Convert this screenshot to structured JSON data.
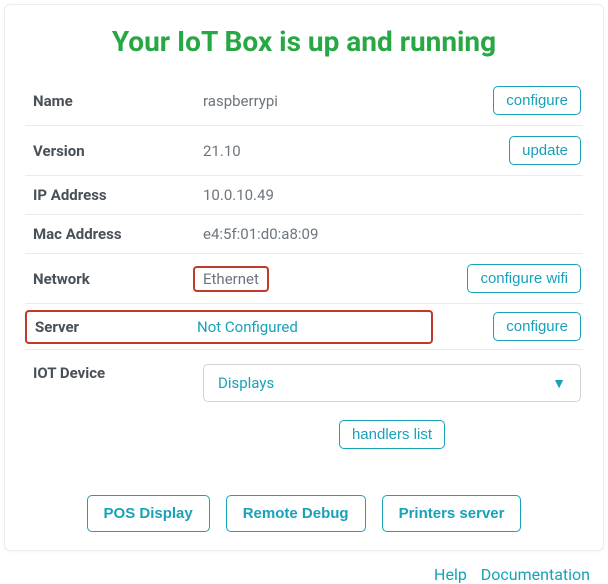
{
  "title": "Your IoT Box is up and running",
  "rows": {
    "name": {
      "label": "Name",
      "value": "raspberrypi",
      "action": "configure"
    },
    "version": {
      "label": "Version",
      "value": "21.10",
      "action": "update"
    },
    "ip": {
      "label": "IP Address",
      "value": "10.0.10.49"
    },
    "mac": {
      "label": "Mac Address",
      "value": "e4:5f:01:d0:a8:09"
    },
    "network": {
      "label": "Network",
      "value": "Ethernet",
      "action": "configure wifi"
    },
    "server": {
      "label": "Server",
      "value": "Not Configured",
      "action": "configure"
    },
    "iot": {
      "label": "IOT Device"
    }
  },
  "dropdown": {
    "selected": "Displays"
  },
  "handlers_button": "handlers list",
  "bottom_buttons": {
    "pos": "POS Display",
    "debug": "Remote Debug",
    "printers": "Printers server"
  },
  "footer": {
    "help": "Help",
    "docs": "Documentation"
  },
  "colors": {
    "accent": "#17a2b8",
    "success": "#28a745",
    "highlight": "#c0392b"
  }
}
